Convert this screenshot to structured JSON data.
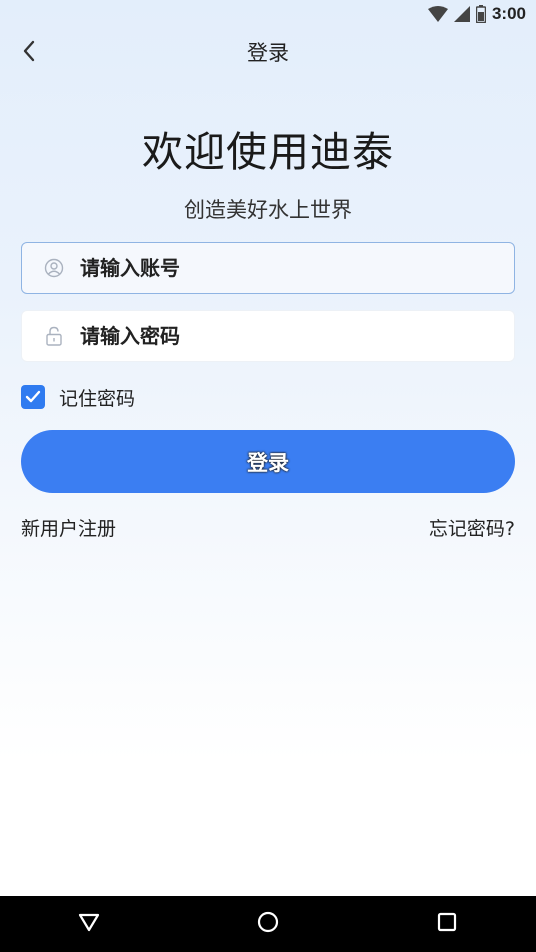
{
  "status_bar": {
    "time": "3:00",
    "icons": [
      "wifi-icon",
      "signal-icon",
      "battery-icon"
    ]
  },
  "header": {
    "title": "登录",
    "back_icon": "chevron-left-icon"
  },
  "welcome": {
    "title": "欢迎使用迪泰",
    "slogan": "创造美好水上世界"
  },
  "form": {
    "account": {
      "placeholder": "请输入账号",
      "value": "",
      "icon": "user-icon"
    },
    "password": {
      "placeholder": "请输入密码",
      "value": "",
      "icon": "lock-icon"
    },
    "remember": {
      "label": "记住密码",
      "checked": true
    },
    "login_label": "登录"
  },
  "links": {
    "register": "新用户注册",
    "forgot": "忘记密码?"
  },
  "nav_bar": {
    "icons": [
      "back-triangle-icon",
      "home-circle-icon",
      "recents-square-icon"
    ]
  },
  "colors": {
    "accent": "#3b7ef2",
    "checkbox": "#2f7bf0",
    "focus_border": "#8fb4e3"
  }
}
